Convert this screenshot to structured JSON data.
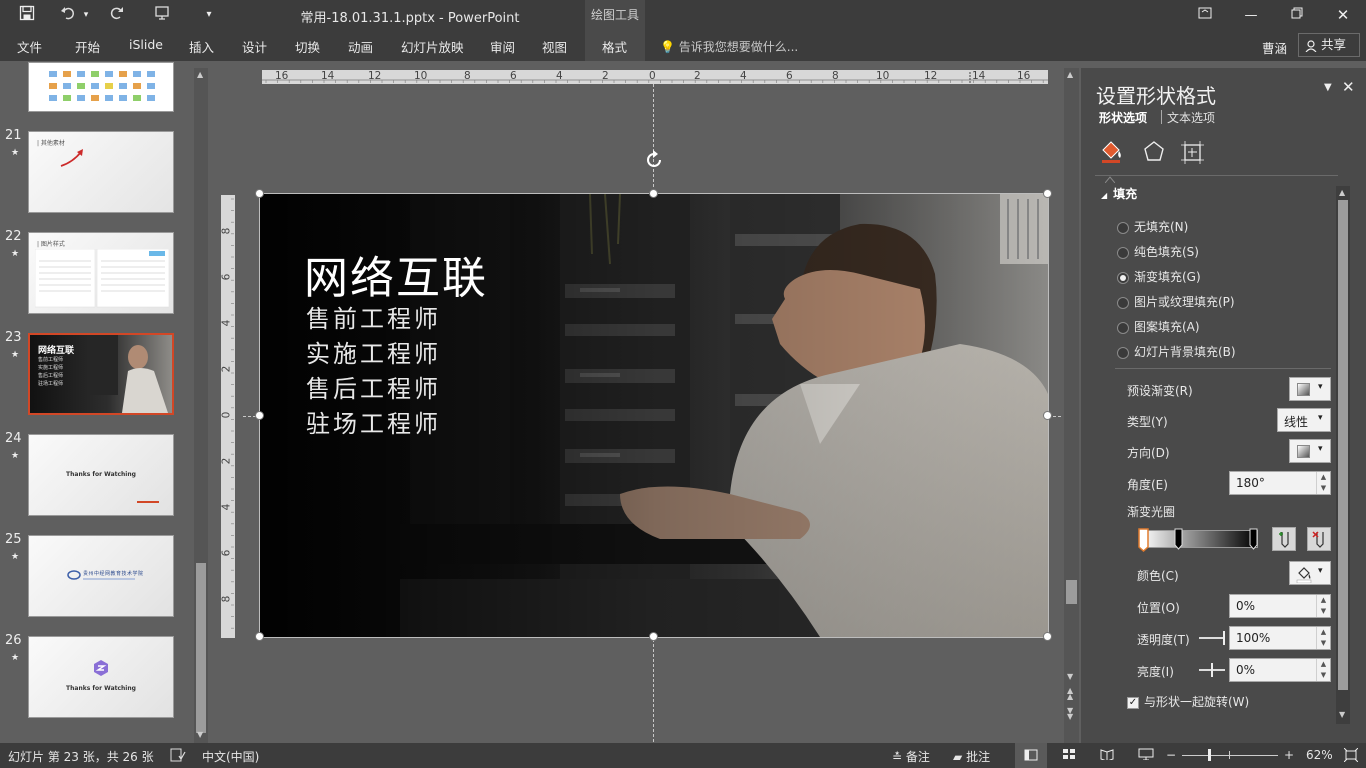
{
  "titlebar": {
    "doc_title": "常用-18.01.31.1.pptx - PowerPoint",
    "context_tab": "绘图工具",
    "save_icon": "save-icon",
    "undo_icon": "undo-icon",
    "redo_icon": "redo-icon"
  },
  "ribbon": {
    "tabs": [
      "文件",
      "开始",
      "iSlide",
      "插入",
      "设计",
      "切换",
      "动画",
      "幻灯片放映",
      "审阅",
      "视图",
      "格式"
    ],
    "active_tab": "格式",
    "tell_me": "告诉我您想要做什么...",
    "account": "曹涵",
    "share": "共享"
  },
  "thumbnails": [
    {
      "num": "21",
      "star": "★",
      "caption": "| 其他素材"
    },
    {
      "num": "22",
      "star": "★",
      "caption": "| 图片样式"
    },
    {
      "num": "23",
      "star": "★",
      "caption": "网络互联",
      "lines": [
        "售前工程师",
        "实施工程师",
        "售后工程师",
        "驻场工程师"
      ]
    },
    {
      "num": "24",
      "star": "★",
      "caption": "Thanks for Watching"
    },
    {
      "num": "25",
      "star": "★",
      "caption": "贵州中经网教育技术学院"
    },
    {
      "num": "26",
      "star": "★",
      "caption": "Thanks for Watching"
    }
  ],
  "ruler": {
    "h_labels": [
      "16",
      "14",
      "12",
      "10",
      "8",
      "6",
      "4",
      "2",
      "0",
      "2",
      "4",
      "6",
      "8",
      "10",
      "12",
      "14",
      "16"
    ],
    "v_labels": [
      "8",
      "6",
      "4",
      "2",
      "0",
      "2",
      "4",
      "6",
      "8"
    ]
  },
  "slide": {
    "title": "网络互联",
    "lines": [
      "售前工程师",
      "实施工程师",
      "售后工程师",
      "驻场工程师"
    ]
  },
  "format_pane": {
    "title": "设置形状格式",
    "tab_shape": "形状选项",
    "tab_text": "文本选项",
    "section": "填充",
    "fill_options": [
      {
        "label": "无填充(N)",
        "checked": false
      },
      {
        "label": "纯色填充(S)",
        "checked": false
      },
      {
        "label": "渐变填充(G)",
        "checked": true
      },
      {
        "label": "图片或纹理填充(P)",
        "checked": false
      },
      {
        "label": "图案填充(A)",
        "checked": false
      },
      {
        "label": "幻灯片背景填充(B)",
        "checked": false
      }
    ],
    "preset_label": "预设渐变(R)",
    "type_label": "类型(Y)",
    "type_value": "线性",
    "direction_label": "方向(D)",
    "angle_label": "角度(E)",
    "angle_value": "180°",
    "stops_label": "渐变光圈",
    "color_label": "颜色(C)",
    "position_label": "位置(O)",
    "position_value": "0%",
    "transparency_label": "透明度(T)",
    "transparency_value": "100%",
    "brightness_label": "亮度(I)",
    "brightness_value": "0%",
    "rotate_label": "与形状一起旋转(W)",
    "rotate_checked": true
  },
  "statusbar": {
    "slide_info": "幻灯片 第 23 张，共 26 张",
    "language": "中文(中国)",
    "notes": "备注",
    "comments": "批注",
    "zoom": "62%"
  },
  "colors": {
    "accent": "#d24726",
    "chrome": "#3c3c3c",
    "pane": "#4a4a4a"
  }
}
